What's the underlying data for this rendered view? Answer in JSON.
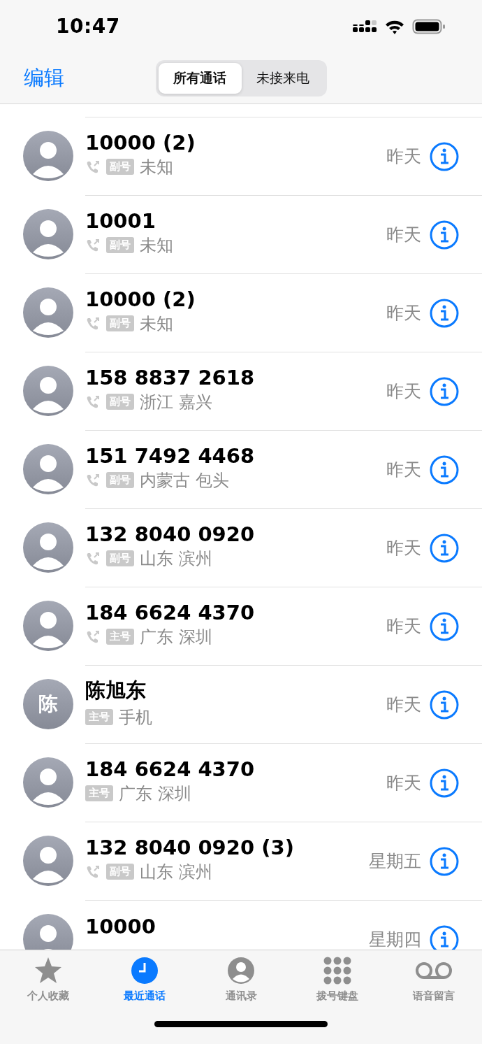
{
  "status_bar": {
    "time": "10:47"
  },
  "nav": {
    "edit": "编辑",
    "segments": [
      {
        "label": "所有通话",
        "selected": true
      },
      {
        "label": "未接来电",
        "selected": false
      }
    ]
  },
  "calls": [
    {
      "name": "10000 (2)",
      "avatar": {
        "kind": "person"
      },
      "outgoing": true,
      "line": "副号",
      "detail": "未知",
      "time": "昨天"
    },
    {
      "name": "10001",
      "avatar": {
        "kind": "person"
      },
      "outgoing": true,
      "line": "副号",
      "detail": "未知",
      "time": "昨天"
    },
    {
      "name": "10000 (2)",
      "avatar": {
        "kind": "person"
      },
      "outgoing": true,
      "line": "副号",
      "detail": "未知",
      "time": "昨天"
    },
    {
      "name": "158 8837 2618",
      "avatar": {
        "kind": "person"
      },
      "outgoing": true,
      "line": "副号",
      "detail": "浙江 嘉兴",
      "time": "昨天"
    },
    {
      "name": "151 7492 4468",
      "avatar": {
        "kind": "person"
      },
      "outgoing": true,
      "line": "副号",
      "detail": "内蒙古 包头",
      "time": "昨天"
    },
    {
      "name": "132 8040 0920",
      "avatar": {
        "kind": "person"
      },
      "outgoing": true,
      "line": "副号",
      "detail": "山东 滨州",
      "time": "昨天"
    },
    {
      "name": "184 6624 4370",
      "avatar": {
        "kind": "person"
      },
      "outgoing": true,
      "line": "主号",
      "detail": "广东 深圳",
      "time": "昨天"
    },
    {
      "name": "陈旭东",
      "avatar": {
        "kind": "initial",
        "text": "陈"
      },
      "outgoing": false,
      "line": "主号",
      "detail": "手机",
      "time": "昨天"
    },
    {
      "name": "184 6624 4370",
      "avatar": {
        "kind": "person"
      },
      "outgoing": false,
      "line": "主号",
      "detail": "广东 深圳",
      "time": "昨天"
    },
    {
      "name": "132 8040 0920 (3)",
      "avatar": {
        "kind": "person"
      },
      "outgoing": true,
      "line": "副号",
      "detail": "山东 滨州",
      "time": "星期五"
    },
    {
      "name": "10000",
      "avatar": {
        "kind": "person"
      },
      "time": "星期四"
    }
  ],
  "tab_bar": [
    {
      "kind": "star",
      "label": "个人收藏",
      "selected": false
    },
    {
      "kind": "clock",
      "label": "最近通话",
      "selected": true
    },
    {
      "kind": "contact",
      "label": "通讯录",
      "selected": false
    },
    {
      "kind": "keypad",
      "label": "拨号键盘",
      "selected": false
    },
    {
      "kind": "voicemail",
      "label": "语音留言",
      "selected": false
    }
  ]
}
